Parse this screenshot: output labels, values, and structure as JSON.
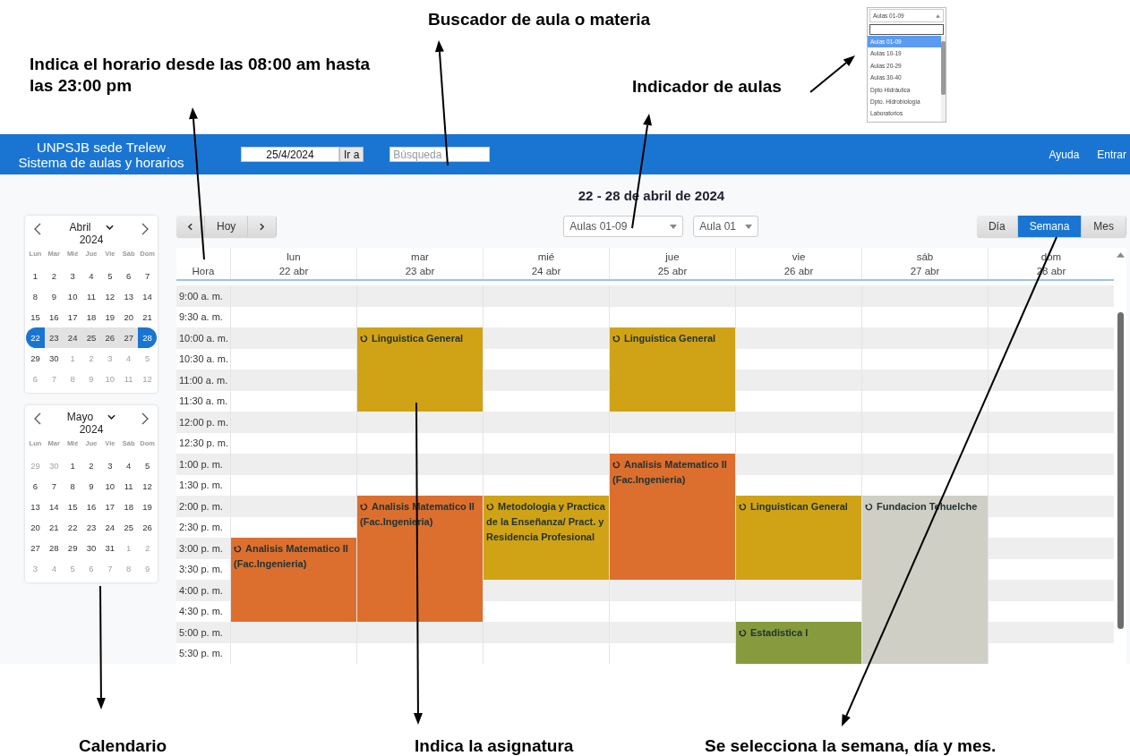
{
  "annotations": [
    {
      "text": "Buscador de aula o materia"
    },
    {
      "text": "Indica el horario desde las 08:00 am hasta las 23:00 pm"
    },
    {
      "text": "Indicador de aulas"
    },
    {
      "text": "Calendario"
    },
    {
      "text": "Indica la asignatura"
    },
    {
      "text": "Se selecciona la semana, día y mes."
    }
  ],
  "dropdown_inset": {
    "value": "Aulas 01-09",
    "options": [
      {
        "label": "Aulas 01-09",
        "selected": true
      },
      {
        "label": "Aulas 10-19",
        "selected": false
      },
      {
        "label": "Aulas 20-29",
        "selected": false
      },
      {
        "label": "Aulas 30-40",
        "selected": false
      },
      {
        "label": "Dpto Hidráulica",
        "selected": false
      },
      {
        "label": "Dpto. Hidrobiología",
        "selected": false
      },
      {
        "label": "Laboratorios",
        "selected": false
      }
    ]
  },
  "header": {
    "title": "UNPSJB sede Trelew",
    "subtitle": "Sistema de aulas y horarios",
    "date_value": "25/4/2024",
    "go_button": "Ir a",
    "search": {
      "placeholder": "Búsqueda"
    },
    "links": [
      "Ayuda",
      "Entrar"
    ]
  },
  "range_title": "22 - 28 de abril de 2024",
  "mini_calendars": [
    {
      "month": "Abril",
      "year": "2024",
      "weekdays": [
        "Lun",
        "Mar",
        "Mié",
        "Jue",
        "Vie",
        "Sáb",
        "Dom"
      ],
      "weeks": [
        {
          "selected": false,
          "days": [
            {
              "n": "1",
              "outside": false
            },
            {
              "n": "2",
              "outside": false
            },
            {
              "n": "3",
              "outside": false
            },
            {
              "n": "4",
              "outside": false
            },
            {
              "n": "5",
              "outside": false
            },
            {
              "n": "6",
              "outside": false
            },
            {
              "n": "7",
              "outside": false
            }
          ]
        },
        {
          "selected": false,
          "days": [
            {
              "n": "8",
              "outside": false
            },
            {
              "n": "9",
              "outside": false
            },
            {
              "n": "10",
              "outside": false
            },
            {
              "n": "11",
              "outside": false
            },
            {
              "n": "12",
              "outside": false
            },
            {
              "n": "13",
              "outside": false
            },
            {
              "n": "14",
              "outside": false
            }
          ]
        },
        {
          "selected": false,
          "days": [
            {
              "n": "15",
              "outside": false
            },
            {
              "n": "16",
              "outside": false
            },
            {
              "n": "17",
              "outside": false
            },
            {
              "n": "18",
              "outside": false
            },
            {
              "n": "19",
              "outside": false
            },
            {
              "n": "20",
              "outside": false
            },
            {
              "n": "21",
              "outside": false
            }
          ]
        },
        {
          "selected": true,
          "days": [
            {
              "n": "22",
              "outside": false
            },
            {
              "n": "23",
              "outside": false
            },
            {
              "n": "24",
              "outside": false
            },
            {
              "n": "25",
              "outside": false
            },
            {
              "n": "26",
              "outside": false
            },
            {
              "n": "27",
              "outside": false
            },
            {
              "n": "28",
              "outside": false
            }
          ]
        },
        {
          "selected": false,
          "days": [
            {
              "n": "29",
              "outside": false
            },
            {
              "n": "30",
              "outside": false
            },
            {
              "n": "1",
              "outside": true
            },
            {
              "n": "2",
              "outside": true
            },
            {
              "n": "3",
              "outside": true
            },
            {
              "n": "4",
              "outside": true
            },
            {
              "n": "5",
              "outside": true
            }
          ]
        },
        {
          "selected": false,
          "days": [
            {
              "n": "6",
              "outside": true
            },
            {
              "n": "7",
              "outside": true
            },
            {
              "n": "8",
              "outside": true
            },
            {
              "n": "9",
              "outside": true
            },
            {
              "n": "10",
              "outside": true
            },
            {
              "n": "11",
              "outside": true
            },
            {
              "n": "12",
              "outside": true
            }
          ]
        }
      ]
    },
    {
      "month": "Mayo",
      "year": "2024",
      "weekdays": [
        "Lun",
        "Mar",
        "Mié",
        "Jue",
        "Vie",
        "Sáb",
        "Dom"
      ],
      "weeks": [
        {
          "selected": false,
          "days": [
            {
              "n": "29",
              "outside": true
            },
            {
              "n": "30",
              "outside": true
            },
            {
              "n": "1",
              "outside": false
            },
            {
              "n": "2",
              "outside": false
            },
            {
              "n": "3",
              "outside": false
            },
            {
              "n": "4",
              "outside": false
            },
            {
              "n": "5",
              "outside": false
            }
          ]
        },
        {
          "selected": false,
          "days": [
            {
              "n": "6",
              "outside": false
            },
            {
              "n": "7",
              "outside": false
            },
            {
              "n": "8",
              "outside": false
            },
            {
              "n": "9",
              "outside": false
            },
            {
              "n": "10",
              "outside": false
            },
            {
              "n": "11",
              "outside": false
            },
            {
              "n": "12",
              "outside": false
            }
          ]
        },
        {
          "selected": false,
          "days": [
            {
              "n": "13",
              "outside": false
            },
            {
              "n": "14",
              "outside": false
            },
            {
              "n": "15",
              "outside": false
            },
            {
              "n": "16",
              "outside": false
            },
            {
              "n": "17",
              "outside": false
            },
            {
              "n": "18",
              "outside": false
            },
            {
              "n": "19",
              "outside": false
            }
          ]
        },
        {
          "selected": false,
          "days": [
            {
              "n": "20",
              "outside": false
            },
            {
              "n": "21",
              "outside": false
            },
            {
              "n": "22",
              "outside": false
            },
            {
              "n": "23",
              "outside": false
            },
            {
              "n": "24",
              "outside": false
            },
            {
              "n": "25",
              "outside": false
            },
            {
              "n": "26",
              "outside": false
            }
          ]
        },
        {
          "selected": false,
          "days": [
            {
              "n": "27",
              "outside": false
            },
            {
              "n": "28",
              "outside": false
            },
            {
              "n": "29",
              "outside": false
            },
            {
              "n": "30",
              "outside": false
            },
            {
              "n": "31",
              "outside": false
            },
            {
              "n": "1",
              "outside": true
            },
            {
              "n": "2",
              "outside": true
            }
          ]
        },
        {
          "selected": false,
          "days": [
            {
              "n": "3",
              "outside": true
            },
            {
              "n": "4",
              "outside": true
            },
            {
              "n": "5",
              "outside": true
            },
            {
              "n": "6",
              "outside": true
            },
            {
              "n": "7",
              "outside": true
            },
            {
              "n": "8",
              "outside": true
            },
            {
              "n": "9",
              "outside": true
            }
          ]
        }
      ]
    }
  ],
  "toolbar": {
    "today_button": "Hoy",
    "area_select": "Aulas 01-09",
    "room_select": "Aula 01",
    "views": [
      {
        "label": "Día",
        "selected": false
      },
      {
        "label": "Semana",
        "selected": true
      },
      {
        "label": "Mes",
        "selected": false
      }
    ]
  },
  "schedule": {
    "hour_heading": "Hora",
    "times": [
      "9:00 a. m.",
      "9:30 a. m.",
      "10:00 a. m.",
      "10:30 a. m.",
      "11:00 a. m.",
      "11:30 a. m.",
      "12:00 p. m.",
      "12:30 p. m.",
      "1:00 p. m.",
      "1:30 p. m.",
      "2:00 p. m.",
      "2:30 p. m.",
      "3:00 p. m.",
      "3:30 p. m.",
      "4:00 p. m.",
      "4:30 p. m.",
      "5:00 p. m.",
      "5:30 p. m."
    ],
    "days": [
      {
        "weekday": "lun",
        "date": "22 abr",
        "slots": [
          {
            "kind": "free"
          },
          {
            "kind": "free"
          },
          {
            "kind": "free"
          },
          {
            "kind": "free"
          },
          {
            "kind": "free"
          },
          {
            "kind": "free"
          },
          {
            "kind": "free"
          },
          {
            "kind": "free"
          },
          {
            "kind": "free"
          },
          {
            "kind": "free"
          },
          {
            "kind": "free"
          },
          {
            "kind": "free"
          },
          {
            "kind": "event",
            "title": "Analisis Matematico II (Fac.Ingenieria)",
            "color": "#dc6f2e"
          },
          {
            "kind": "cont"
          },
          {
            "kind": "cont"
          },
          {
            "kind": "cont"
          },
          {
            "kind": "free"
          },
          {
            "kind": "free"
          }
        ]
      },
      {
        "weekday": "mar",
        "date": "23 abr",
        "slots": [
          {
            "kind": "free"
          },
          {
            "kind": "free"
          },
          {
            "kind": "event",
            "title": "Linguistica General",
            "color": "#d0a317"
          },
          {
            "kind": "cont"
          },
          {
            "kind": "cont"
          },
          {
            "kind": "cont"
          },
          {
            "kind": "free"
          },
          {
            "kind": "free"
          },
          {
            "kind": "free"
          },
          {
            "kind": "free"
          },
          {
            "kind": "event",
            "title": "Analisis Matematico II (Fac.Ingenieria)",
            "color": "#dc6f2e"
          },
          {
            "kind": "cont"
          },
          {
            "kind": "cont"
          },
          {
            "kind": "cont"
          },
          {
            "kind": "cont"
          },
          {
            "kind": "cont"
          },
          {
            "kind": "free"
          },
          {
            "kind": "free"
          }
        ]
      },
      {
        "weekday": "mié",
        "date": "24 abr",
        "slots": [
          {
            "kind": "free"
          },
          {
            "kind": "free"
          },
          {
            "kind": "free"
          },
          {
            "kind": "free"
          },
          {
            "kind": "free"
          },
          {
            "kind": "free"
          },
          {
            "kind": "free"
          },
          {
            "kind": "free"
          },
          {
            "kind": "free"
          },
          {
            "kind": "free"
          },
          {
            "kind": "event",
            "title": "Metodologia y Practica de la Enseñanza/ Pract. y Residencia Profesional",
            "color": "#d0a317"
          },
          {
            "kind": "cont"
          },
          {
            "kind": "cont"
          },
          {
            "kind": "cont"
          },
          {
            "kind": "free"
          },
          {
            "kind": "free"
          },
          {
            "kind": "free"
          },
          {
            "kind": "free"
          }
        ]
      },
      {
        "weekday": "jue",
        "date": "25 abr",
        "slots": [
          {
            "kind": "free"
          },
          {
            "kind": "free"
          },
          {
            "kind": "event",
            "title": "Linguistica General",
            "color": "#d0a317"
          },
          {
            "kind": "cont"
          },
          {
            "kind": "cont"
          },
          {
            "kind": "cont"
          },
          {
            "kind": "free"
          },
          {
            "kind": "free"
          },
          {
            "kind": "event",
            "title": "Analisis Matematico II (Fac.Ingenieria)",
            "color": "#dc6f2e"
          },
          {
            "kind": "cont"
          },
          {
            "kind": "cont"
          },
          {
            "kind": "cont"
          },
          {
            "kind": "cont"
          },
          {
            "kind": "cont"
          },
          {
            "kind": "free"
          },
          {
            "kind": "free"
          },
          {
            "kind": "free"
          },
          {
            "kind": "free"
          }
        ]
      },
      {
        "weekday": "vie",
        "date": "26 abr",
        "slots": [
          {
            "kind": "free"
          },
          {
            "kind": "free"
          },
          {
            "kind": "free"
          },
          {
            "kind": "free"
          },
          {
            "kind": "free"
          },
          {
            "kind": "free"
          },
          {
            "kind": "free"
          },
          {
            "kind": "free"
          },
          {
            "kind": "free"
          },
          {
            "kind": "free"
          },
          {
            "kind": "event",
            "title": "Linguistican General",
            "color": "#d0a317"
          },
          {
            "kind": "cont"
          },
          {
            "kind": "cont"
          },
          {
            "kind": "cont"
          },
          {
            "kind": "free"
          },
          {
            "kind": "free"
          },
          {
            "kind": "event",
            "title": "Estadistica I",
            "color": "#879b3e"
          },
          {
            "kind": "cont"
          }
        ]
      },
      {
        "weekday": "sáb",
        "date": "27 abr",
        "slots": [
          {
            "kind": "free"
          },
          {
            "kind": "free"
          },
          {
            "kind": "free"
          },
          {
            "kind": "free"
          },
          {
            "kind": "free"
          },
          {
            "kind": "free"
          },
          {
            "kind": "free"
          },
          {
            "kind": "free"
          },
          {
            "kind": "free"
          },
          {
            "kind": "free"
          },
          {
            "kind": "event",
            "title": "Fundacion Tehuelche",
            "color": "#cfcfc6"
          },
          {
            "kind": "cont"
          },
          {
            "kind": "cont"
          },
          {
            "kind": "cont"
          },
          {
            "kind": "cont"
          },
          {
            "kind": "cont"
          },
          {
            "kind": "cont"
          },
          {
            "kind": "cont"
          }
        ]
      },
      {
        "weekday": "dom",
        "date": "28 abr",
        "slots": [
          {
            "kind": "free"
          },
          {
            "kind": "free"
          },
          {
            "kind": "free"
          },
          {
            "kind": "free"
          },
          {
            "kind": "free"
          },
          {
            "kind": "free"
          },
          {
            "kind": "free"
          },
          {
            "kind": "free"
          },
          {
            "kind": "free"
          },
          {
            "kind": "free"
          },
          {
            "kind": "free"
          },
          {
            "kind": "free"
          },
          {
            "kind": "free"
          },
          {
            "kind": "free"
          },
          {
            "kind": "free"
          },
          {
            "kind": "free"
          },
          {
            "kind": "free"
          },
          {
            "kind": "free"
          }
        ]
      }
    ]
  }
}
